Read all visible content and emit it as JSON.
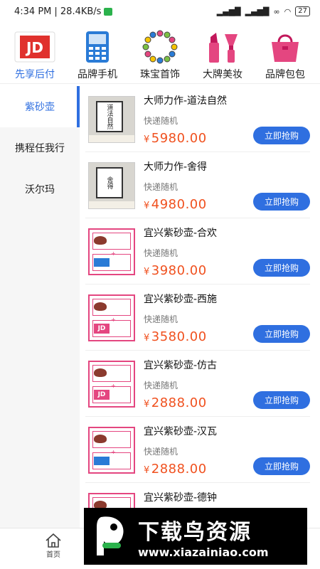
{
  "status_bar": {
    "time": "4:34 PM",
    "speed": "| 28.4KB/s",
    "battery": "27"
  },
  "categories": [
    {
      "label": "先享后付",
      "icon": "jd-card-icon",
      "active": true
    },
    {
      "label": "品牌手机",
      "icon": "phone-icon",
      "active": false
    },
    {
      "label": "珠宝首饰",
      "icon": "necklace-icon",
      "active": false
    },
    {
      "label": "大牌美妆",
      "icon": "lipstick-icon",
      "active": false
    },
    {
      "label": "品牌包包",
      "icon": "handbag-icon",
      "active": false
    }
  ],
  "sidebar": [
    {
      "label": "紫砂壶",
      "active": true
    },
    {
      "label": "携程任我行",
      "active": false
    },
    {
      "label": "沃尔玛",
      "active": false
    }
  ],
  "products": [
    {
      "name": "大师力作-道法自然",
      "shipping": "快递随机",
      "currency": "¥",
      "price": "5980.00",
      "button": "立即抢购",
      "thumb_text": "道法自然"
    },
    {
      "name": "大师力作-舍得",
      "shipping": "快递随机",
      "currency": "¥",
      "price": "4980.00",
      "button": "立即抢购",
      "thumb_text": "舍得"
    },
    {
      "name": "宜兴紫砂壶-合欢",
      "shipping": "快递随机",
      "currency": "¥",
      "price": "3980.00",
      "button": "立即抢购"
    },
    {
      "name": "宜兴紫砂壶-西施",
      "shipping": "快递随机",
      "currency": "¥",
      "price": "3580.00",
      "button": "立即抢购"
    },
    {
      "name": "宜兴紫砂壶-仿古",
      "shipping": "快递随机",
      "currency": "¥",
      "price": "2888.00",
      "button": "立即抢购"
    },
    {
      "name": "宜兴紫砂壶-汉瓦",
      "shipping": "快递随机",
      "currency": "¥",
      "price": "2888.00",
      "button": "立即抢购"
    },
    {
      "name": "宜兴紫砂壶-德钟",
      "shipping": "",
      "currency": "",
      "price": "",
      "button": ""
    }
  ],
  "bottom_nav": {
    "home_label": "首页"
  },
  "watermark": {
    "title": "下载鸟资源",
    "url": "www.xiazainiao.com"
  },
  "colors": {
    "accent": "#2f6fe0",
    "price": "#f0511f",
    "card_pink": "#e44680"
  }
}
